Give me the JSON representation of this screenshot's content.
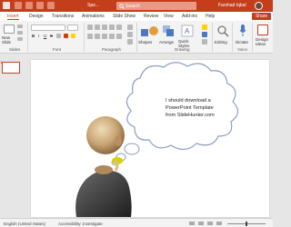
{
  "titlebar": {
    "doc_name": "Spe...",
    "search_placeholder": "Search",
    "user_name": "Farshad Iqbal"
  },
  "menubar": {
    "tabs": [
      "Insert",
      "Design",
      "Transitions",
      "Animations",
      "Slide Show",
      "Review",
      "View",
      "Add-ins",
      "Help"
    ],
    "active_tab_index": 0,
    "share_label": "Share"
  },
  "ribbon": {
    "new_slide_label": "New\nSlide",
    "groups": {
      "slides": "Slides",
      "font": "Font",
      "paragraph": "Paragraph",
      "drawing": "Drawing",
      "voice": "Voice"
    },
    "shapes_label": "Shapes",
    "arrange_label": "Arrange",
    "quick_styles_label": "Quick Styles",
    "editing_label": "Editing",
    "dictate_label": "Dictate",
    "design_ideas_label": "Design Ideas"
  },
  "thumbnail": {
    "number": "1"
  },
  "slide": {
    "cloud_lines": [
      "I should download a",
      "PowerPoint Template",
      "from SlideHunter.com"
    ]
  },
  "statusbar": {
    "language": "English (United States)",
    "accessibility": "Accessibility: Investigate"
  },
  "colors": {
    "accent": "#c43e1c"
  }
}
